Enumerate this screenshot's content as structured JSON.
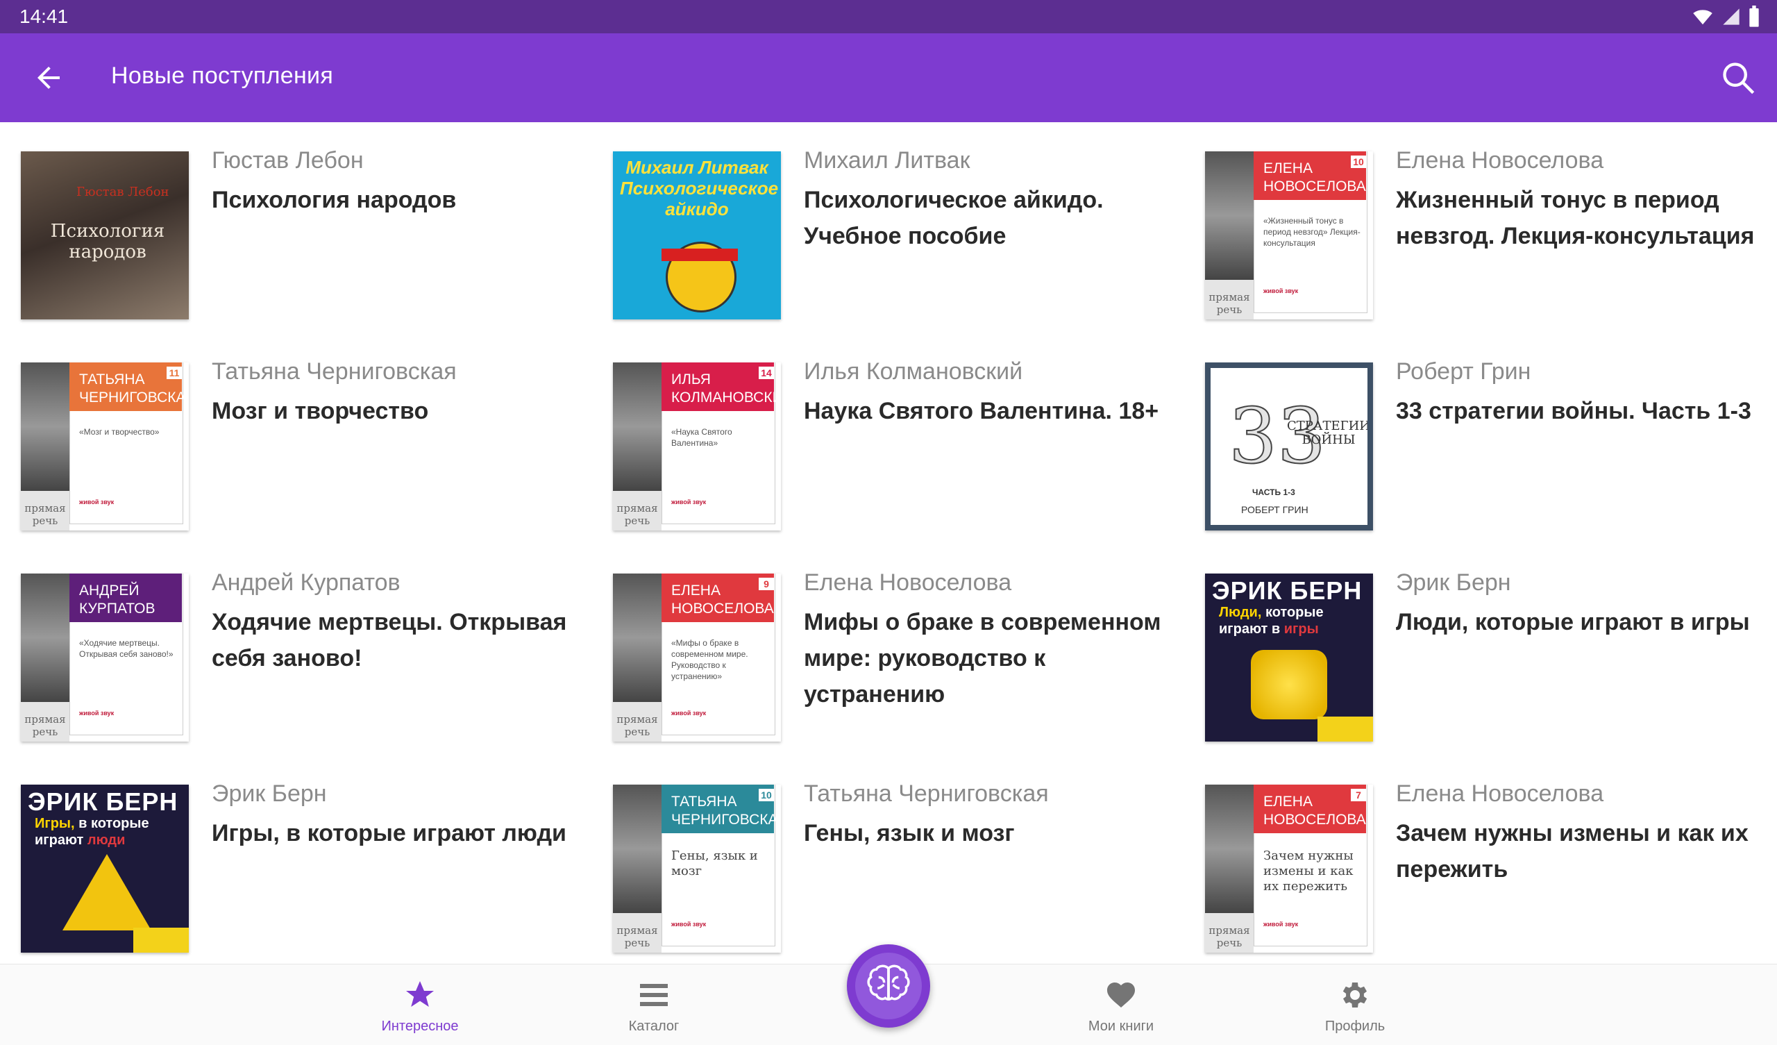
{
  "status_bar": {
    "time": "14:41"
  },
  "app_bar": {
    "title": "Новые поступления",
    "back_icon": "arrow-back-icon",
    "search_icon": "search-icon"
  },
  "books": [
    {
      "author": "Гюстав Лебон",
      "title": "Психология народов",
      "cover": {
        "style": "dark",
        "line1": "Психология",
        "line2": "народов",
        "author": "Гюстав Лебон"
      }
    },
    {
      "author": "Михаил Литвак",
      "title": "Психологическое айкидо. Учебное пособие",
      "cover": {
        "style": "cyan",
        "line1": "Михаил Литвак",
        "line2": "Психологическое",
        "line3": "айкидо"
      }
    },
    {
      "author": "Елена Новоселова",
      "title": "Жизненный тонус в период невзгод. Лекция-консультация",
      "cover": {
        "style": "pr",
        "color": "#e0393e",
        "name": "ЕЛЕНА НОВОСЕЛОВА",
        "num": "10",
        "sub": "«Жизненный тонус в период невзгод» Лекция-консультация",
        "logo": "прямая речь",
        "live": "живой звук"
      }
    },
    {
      "author": "Татьяна Черниговская",
      "title": "Мозг и творчество",
      "cover": {
        "style": "pr",
        "color": "#e8743a",
        "name": "ТАТЬЯНА ЧЕРНИГОВСКАЯ",
        "num": "11",
        "sub": "«Мозг и творчество»",
        "logo": "прямая речь",
        "live": "живой звук"
      }
    },
    {
      "author": "Илья Колмановский",
      "title": "Наука Святого Валентина. 18+",
      "cover": {
        "style": "pr",
        "color": "#d81e4a",
        "name": "ИЛЬЯ КОЛМАНОВСКИЙ",
        "num": "14",
        "sub": "«Наука Святого Валентина»",
        "logo": "прямая речь",
        "live": "живой звук"
      }
    },
    {
      "author": "Роберт Грин",
      "title": "33 стратегии войны. Часть 1-3",
      "cover": {
        "style": "green33",
        "big": "33",
        "line1": "СТРАТЕГИИ ВОЙНЫ",
        "part": "ЧАСТЬ 1-3",
        "name": "РОБЕРТ ГРИН"
      }
    },
    {
      "author": "Андрей Курпатов",
      "title": "Ходячие мертвецы. Открывая себя заново!",
      "cover": {
        "style": "pr",
        "color": "#5e1f7a",
        "name": "АНДРЕЙ КУРПАТОВ",
        "num": "",
        "sub": "«Ходячие мертвецы. Открывая себя заново!»",
        "logo": "прямая речь",
        "live": "живой звук"
      }
    },
    {
      "author": "Елена Новоселова",
      "title": "Мифы о браке в современном мире: руководство к устранению",
      "cover": {
        "style": "pr",
        "color": "#e0393e",
        "name": "ЕЛЕНА НОВОСЕЛОВА",
        "num": "9",
        "sub": "«Мифы о браке в современном мире. Руководство к устранению»",
        "logo": "прямая речь",
        "live": "живой звук"
      }
    },
    {
      "author": "Эрик Берн",
      "title": "Люди, которые играют в игры",
      "cover": {
        "style": "bern",
        "line1": "ЭРИК БЕРН",
        "line2a": "Люди,",
        "line2b": " которые",
        "line3a": "играют в ",
        "line3b": "игры"
      }
    },
    {
      "author": "Эрик Берн",
      "title": "Игры, в которые играют люди",
      "cover": {
        "style": "bern",
        "line1": "ЭРИК БЕРН",
        "line2a": "Игры,",
        "line2b": " в которые",
        "line3a": "играют ",
        "line3b": "люди"
      }
    },
    {
      "author": "Татьяна Черниговская",
      "title": "Гены, язык и мозг",
      "cover": {
        "style": "pr",
        "color": "#2b8a9a",
        "name": "ТАТЬЯНА ЧЕРНИГОВСКАЯ",
        "num": "10",
        "serif": "Гены, язык и мозг",
        "logo": "прямая речь",
        "live": "живой звук"
      }
    },
    {
      "author": "Елена Новоселова",
      "title": "Зачем нужны измены и как их пережить",
      "cover": {
        "style": "pr",
        "color": "#e0393e",
        "name": "ЕЛЕНА НОВОСЕЛОВА",
        "num": "7",
        "serif": "Зачем нужны измены и как их пережить",
        "logo": "прямая речь",
        "live": "живой звук"
      }
    }
  ],
  "nav": {
    "items": [
      {
        "label": "Интересное",
        "icon": "star-icon",
        "active": true
      },
      {
        "label": "Каталог",
        "icon": "list-icon",
        "active": false
      },
      {
        "label": "Мои книги",
        "icon": "heart-icon",
        "active": false
      },
      {
        "label": "Профиль",
        "icon": "gear-icon",
        "active": false
      }
    ],
    "fab_icon": "brain-icon"
  },
  "colors": {
    "status_bar": "#5c2e91",
    "app_bar": "#7e3bd0",
    "accent": "#7e3bd0",
    "text_author": "#8a8a8a",
    "text_title": "#2a2a2a"
  }
}
